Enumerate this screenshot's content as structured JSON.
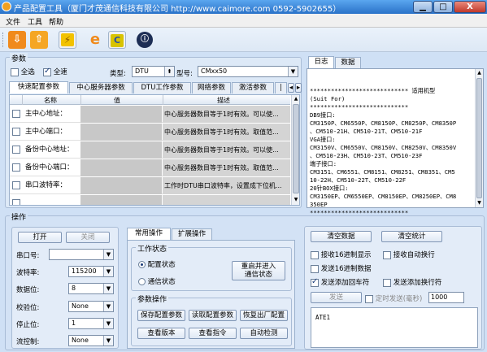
{
  "window": {
    "title": "产品配置工具（厦门才茂通信科技有限公司 http://www.caimore.com 0592-5902655）",
    "minimize": "▁",
    "maximize": "□",
    "close": "X"
  },
  "menu": [
    "文件",
    "工具",
    "帮助"
  ],
  "toolbar": {
    "b3": "e"
  },
  "params": {
    "title": "参数",
    "select_all_label": "全选",
    "full_speed_label": "全速",
    "type_label": "类型:",
    "type_value": "DTU",
    "model_label": "型号:",
    "model_value": "CMxx50",
    "tabs": [
      "快速配置参数",
      "中心服务器参数",
      "DTU工作参数",
      "网络参数",
      "激活参数"
    ],
    "table_headers": {
      "name": "名称",
      "value": "值",
      "desc": "描述"
    },
    "rows": [
      {
        "name": "主中心地址：",
        "value": "",
        "desc": "中心服务器数目等于1时有效。可以使..."
      },
      {
        "name": "主中心端口：",
        "value": "",
        "desc": "中心服务器数目等于1时有效。取值范..."
      },
      {
        "name": "备份中心地址：",
        "value": "",
        "desc": "中心服务器数目等于1时有效。可以使..."
      },
      {
        "name": "备份中心端口：",
        "value": "",
        "desc": "中心服务器数目等于1时有效。取值范..."
      },
      {
        "name": "串口波特率：",
        "value": "",
        "desc": "工作时DTU串口波特率，设置成下位机..."
      }
    ]
  },
  "log": {
    "tabs": [
      "日志",
      "数据"
    ],
    "lines": [
      "**************************** 适用机型",
      "(Suit For)",
      "****************************",
      "DB9接口:",
      "CM3150P、CM6550P、CM8150P、CM8250P、CM8350P",
      "、CM510-21H、CM510-21T、CM510-21F",
      "VGA接口:",
      "CM3150V、CM6550V、CM8150V、CM8250V、CM8350V",
      "、CM510-23H、CM510-23T、CM510-23F",
      "端子接口:",
      "CM3151、CM6551、CM8151、CM8251、CM8351、CM5",
      "10-22H、CM510-22T、CM510-22F",
      "20针BOX接口:",
      "CM3150EP、CM6550EP、CM8150EP、CM8250EP、CM8",
      "350EP",
      "****************************"
    ]
  },
  "operations": {
    "title": "操作",
    "open": "打开",
    "close": "关闭",
    "serial_label": "串口号:",
    "serial_value": "",
    "baud_label": "波特率:",
    "baud_value": "115200",
    "databits_label": "数据位:",
    "databits_value": "8",
    "parity_label": "校验位:",
    "parity_value": "None",
    "stopbits_label": "停止位:",
    "stopbits_value": "1",
    "flow_label": "流控制:",
    "flow_value": "None"
  },
  "common_ops": {
    "tabs": [
      "常用操作",
      "扩展操作"
    ],
    "work_state_title": "工作状态",
    "config_state": "配置状态",
    "comm_state": "通信状态",
    "restart_btn_line1": "重启并进入",
    "restart_btn_line2": "通信状态",
    "param_ops_title": "参数操作",
    "save_params": "保存配置参数",
    "read_params": "读取配置参数",
    "restore_factory": "恢复出厂配置",
    "view_version": "查看版本",
    "view_command": "查看指令",
    "auto_detect": "自动检测"
  },
  "send_area": {
    "clear_data": "清空数据",
    "clear_stats": "清空统计",
    "recv_hex": "接收16进制显示",
    "recv_autowrap": "接收自动换行",
    "send_hex": "发送16进制数据",
    "send_cr": "发送添加回车符",
    "send_lf": "发送添加换行符",
    "send_btn": "发送",
    "timed_send": "定时发送(毫秒)",
    "interval": "1000",
    "input_text": "ATE1"
  }
}
